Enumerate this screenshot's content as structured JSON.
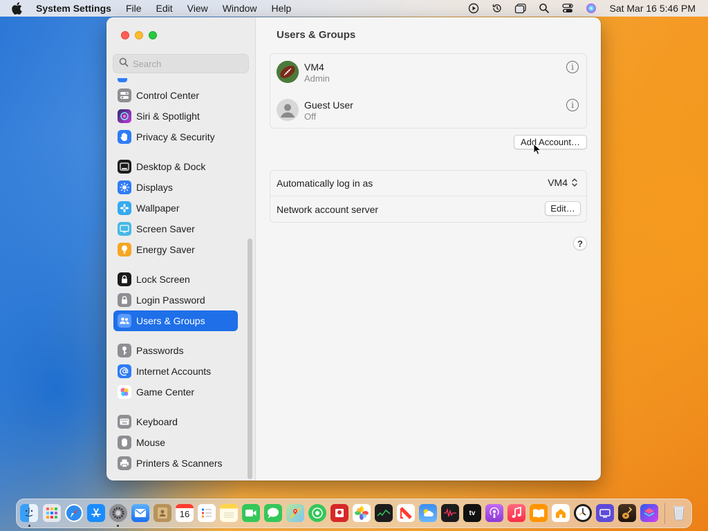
{
  "menubar": {
    "app_name": "System Settings",
    "menus": [
      "File",
      "Edit",
      "View",
      "Window",
      "Help"
    ],
    "clock": "Sat Mar 16  5:46 PM",
    "status_icons": [
      "play-circle-icon",
      "time-machine-icon",
      "window-icon",
      "search-icon",
      "control-center-icon",
      "siri-icon"
    ]
  },
  "sidebar": {
    "search_placeholder": "Search",
    "items": [
      {
        "label": "Control Center",
        "icon": "control-center-icon",
        "color": "#8e8e93"
      },
      {
        "label": "Siri & Spotlight",
        "icon": "siri-icon",
        "color": "#b13ad8"
      },
      {
        "label": "Privacy & Security",
        "icon": "hand-icon",
        "color": "#2f7cf6"
      },
      {
        "label": "Desktop & Dock",
        "icon": "dock-icon",
        "color": "#1c1c1e"
      },
      {
        "label": "Displays",
        "icon": "sun-icon",
        "color": "#2f7cf6"
      },
      {
        "label": "Wallpaper",
        "icon": "flower-icon",
        "color": "#35aaf0"
      },
      {
        "label": "Screen Saver",
        "icon": "screen-saver-icon",
        "color": "#46b8e6"
      },
      {
        "label": "Energy Saver",
        "icon": "bulb-icon",
        "color": "#f5a623"
      },
      {
        "label": "Lock Screen",
        "icon": "lock-icon",
        "color": "#1c1c1e"
      },
      {
        "label": "Login Password",
        "icon": "lock-icon",
        "color": "#8e8e93"
      },
      {
        "label": "Users & Groups",
        "icon": "users-icon",
        "color": "#2f7cf6"
      },
      {
        "label": "Passwords",
        "icon": "key-icon",
        "color": "#8e8e93"
      },
      {
        "label": "Internet Accounts",
        "icon": "at-icon",
        "color": "#2f7cf6"
      },
      {
        "label": "Game Center",
        "icon": "game-center-icon",
        "color": "#ffffff"
      },
      {
        "label": "Keyboard",
        "icon": "keyboard-icon",
        "color": "#8e8e93"
      },
      {
        "label": "Mouse",
        "icon": "mouse-icon",
        "color": "#8e8e93"
      },
      {
        "label": "Printers & Scanners",
        "icon": "printer-icon",
        "color": "#8e8e93"
      }
    ],
    "selected": "Users & Groups"
  },
  "main": {
    "title": "Users & Groups",
    "users": [
      {
        "name": "VM4",
        "role": "Admin",
        "avatar": "football-avatar"
      },
      {
        "name": "Guest User",
        "role": "Off",
        "avatar": "person-avatar"
      }
    ],
    "info_glyph": "i",
    "add_account_label": "Add Account…",
    "auto_login_label": "Automatically log in as",
    "auto_login_value": "VM4",
    "network_server_label": "Network account server",
    "edit_label": "Edit…",
    "help_label": "?"
  },
  "dock": {
    "apps": [
      "Finder",
      "Launchpad",
      "Safari",
      "App Store",
      "System Settings",
      "Mail",
      "Contacts",
      "Calendar",
      "Reminders",
      "Notes",
      "FaceTime",
      "Messages",
      "Maps",
      "Find My",
      "Photo Booth",
      "Photos",
      "Stocks",
      "News",
      "Weather",
      "Podcasts-dark",
      "TV",
      "Podcasts",
      "Music",
      "Books",
      "Home",
      "Clock",
      "Screen Time",
      "GarageBand",
      "Shortcuts",
      "Trash"
    ],
    "calendar_day": "16",
    "tv_label": "tv"
  },
  "colors": {
    "accent": "#1e6fe8",
    "close": "#ff5f57",
    "minimize": "#febc2e",
    "zoom": "#28c840"
  }
}
